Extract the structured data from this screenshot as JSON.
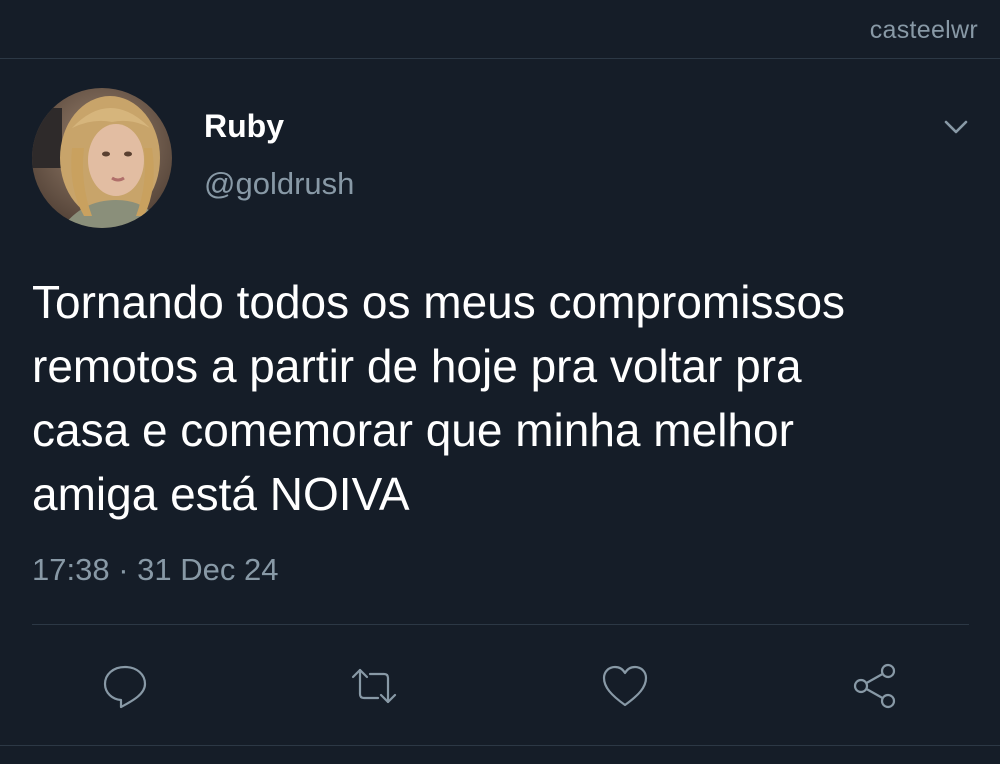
{
  "watermark": "casteelwr",
  "user": {
    "display_name": "Ruby",
    "handle": "@goldrush",
    "avatar_icon": "profile-photo"
  },
  "tweet": {
    "text_lines": [
      "Tornando todos os meus compromissos",
      "remotos a partir de hoje pra voltar pra",
      "casa e comemorar que minha melhor",
      "amiga está NOIVA"
    ],
    "timestamp": "17:38 · 31 Dec 24"
  },
  "actions": [
    {
      "name": "reply",
      "icon": "speech-bubble-icon"
    },
    {
      "name": "retweet",
      "icon": "retweet-arrows-icon"
    },
    {
      "name": "like",
      "icon": "heart-icon"
    },
    {
      "name": "share",
      "icon": "share-nodes-icon"
    }
  ],
  "colors": {
    "background": "#151d28",
    "secondary_text": "#8899a6",
    "divider": "#2c3845"
  }
}
